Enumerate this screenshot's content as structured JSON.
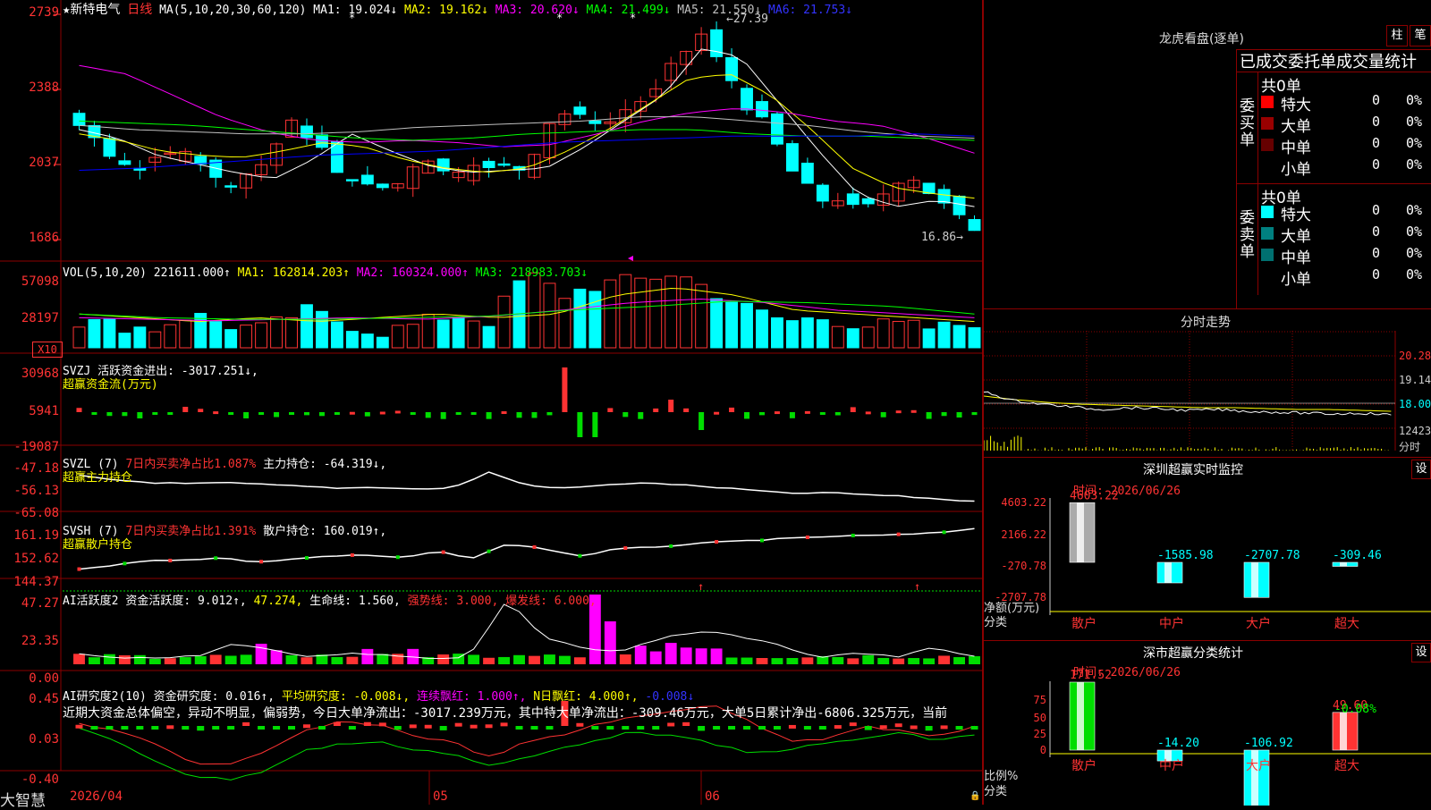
{
  "stock": {
    "name": "★新特电气",
    "period": "日线"
  },
  "candle_pane": {
    "ma_header": {
      "ma_params": "MA(5,10,20,30,60,120)",
      "ma1": "MA1: 19.024↓",
      "ma2": "MA2: 19.162↓",
      "ma3": "MA3: 20.620↓",
      "ma4": "MA4: 21.499↓",
      "ma5": "MA5: 21.550↓",
      "ma6": "MA6: 21.753↓"
    },
    "y_ticks": [
      "2739",
      "2388",
      "2037",
      "1686"
    ],
    "high_label": "27.39",
    "low_label": "16.86"
  },
  "volume_pane": {
    "header": {
      "name": "VOL(5,10,20)",
      "v": "221611.000↑",
      "ma1": "MA1: 162814.203↑",
      "ma2": "MA2: 160324.000↑",
      "ma3": "MA3: 218983.703↓"
    },
    "y_ticks": [
      "57098",
      "28197"
    ],
    "unit": "X10"
  },
  "svzj_pane": {
    "header": {
      "name": "SVZJ",
      "text": "活跃资金进出: -3017.251↓,",
      "subtitle": "超赢资金流(万元)"
    },
    "y_ticks": [
      "30968",
      "5941",
      "-19087"
    ]
  },
  "svzl_pane": {
    "header": {
      "name": "SVZL (7)",
      "pct": "7日内买卖净占比1.087%",
      "hold": "主力持仓: -64.319↓,",
      "subtitle": "超赢主力持仓"
    },
    "y_ticks": [
      "-47.18",
      "-56.13",
      "-65.08"
    ]
  },
  "svsh_pane": {
    "header": {
      "name": "SVSH (7)",
      "pct": "7日内买卖净占比1.391%",
      "hold": "散户持仓: 160.019↑,",
      "subtitle": "超赢散户持仓"
    },
    "y_ticks": [
      "161.19",
      "152.62",
      "144.37"
    ]
  },
  "ai_active_pane": {
    "header": {
      "name": "AI活跃度2",
      "act": "资金活跃度: 9.012↑,",
      "v2": "47.274,",
      "life": "生命线: 1.560,",
      "strong": "强势线: 3.000,",
      "burst": "爆发线: 6.000,"
    },
    "y_ticks": [
      "47.27",
      "23.35",
      "0.00"
    ]
  },
  "ai_research_pane": {
    "header": {
      "name": "AI研究度2(10)",
      "res": "资金研究度: 0.016↑,",
      "avg": "平均研究度: -0.008↓,",
      "red": "连续飘红: 1.000↑,",
      "nred": "N日飘红: 4.000↑,",
      "last": "-0.008↓"
    },
    "commentary": "近期大资金总体偏空，异动不明显，偏弱势，今日大单净流出：-3017.239万元，其中特大单净流出：-309.46万元，大单5日累计净出-6806.325万元，当前",
    "y_ticks": [
      "0.45",
      "0.03",
      "-0.40"
    ]
  },
  "date_axis": {
    "start": "2026/04",
    "m1": "05",
    "m2": "06"
  },
  "app_brand": "大智慧",
  "dragon_tiger": {
    "title": "龙虎看盘(逐单)",
    "btn_bar": "柱",
    "btn_stroke": "笔",
    "table_title": "已成交委托单成交量统计",
    "buy": {
      "side": "委买单",
      "total": "共0单",
      "rows": [
        {
          "label": "特大",
          "count": "0",
          "pct": "0%",
          "color": "#ff0000"
        },
        {
          "label": "大单",
          "count": "0",
          "pct": "0%",
          "color": "#990000"
        },
        {
          "label": "中单",
          "count": "0",
          "pct": "0%",
          "color": "#660000"
        },
        {
          "label": "小单",
          "count": "0",
          "pct": "0%",
          "color": "#000000"
        }
      ]
    },
    "sell": {
      "side": "委卖单",
      "total": "共0单",
      "rows": [
        {
          "label": "特大",
          "count": "0",
          "pct": "0%",
          "color": "#00ffff"
        },
        {
          "label": "大单",
          "count": "0",
          "pct": "0%",
          "color": "#008080"
        },
        {
          "label": "中单",
          "count": "0",
          "pct": "0%",
          "color": "#007070"
        },
        {
          "label": "小单",
          "count": "0",
          "pct": "0%",
          "color": "#000000"
        }
      ]
    }
  },
  "intraday": {
    "title": "分时走势",
    "y_ticks": [
      "20.28",
      "19.14",
      "18.00",
      "12423"
    ],
    "foot_label": "分时"
  },
  "sz_monitor": {
    "title": "深圳超赢实时监控",
    "setting_btn": "设",
    "time_label": "时间: 2026/06/26",
    "y_ticks": [
      "4603.22",
      "2166.22",
      "-270.78",
      "-2707.78"
    ],
    "y_unit": "净额(万元)",
    "x_caption": "分类",
    "categories": [
      "散户",
      "中户",
      "大户",
      "超大"
    ],
    "values": [
      4603.22,
      -1585.98,
      -2707.78,
      -309.46
    ],
    "value_labels": [
      "4603.22",
      "-1585.98",
      "-2707.78",
      "-309.46"
    ]
  },
  "sz_classify": {
    "title": "深市超赢分类统计",
    "setting_btn": "设",
    "time_label": "时间: 2026/06/26",
    "y_ticks": [
      "75",
      "50",
      "25",
      "0"
    ],
    "y_unit": "比例%",
    "x_caption": "分类",
    "categories": [
      "散户",
      "中户",
      "大户",
      "超大"
    ],
    "values": [
      171.52,
      -14.2,
      -106.92,
      49.6
    ],
    "value_labels": [
      "171.52",
      "-14.20",
      "-106.92",
      "49.60"
    ],
    "extra_label": "-0.08%"
  },
  "colors": {
    "up": "#ff3333",
    "down": "#00ffff",
    "grid": "#8b0000",
    "ma1": "#ffffff",
    "ma2": "#ffff00",
    "ma3": "#ff00ff",
    "ma4": "#00ff00",
    "ma5": "#c0c0c0",
    "ma6": "#0000ff"
  }
}
